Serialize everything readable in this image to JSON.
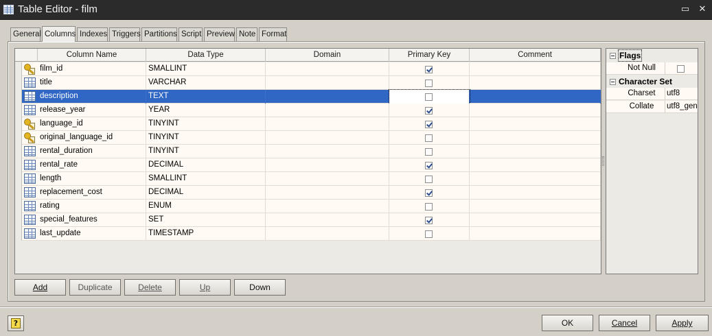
{
  "window": {
    "title": "Table Editor - film",
    "minimize_glyph": "▭",
    "close_glyph": "✕"
  },
  "tabs": [
    "General",
    "Columns",
    "Indexes",
    "Triggers",
    "Partitions",
    "Script",
    "Preview",
    "Note",
    "Format"
  ],
  "active_tab": "Columns",
  "grid": {
    "headers": [
      "Column Name",
      "Data Type",
      "Domain",
      "Primary Key",
      "Comment"
    ],
    "selected_row": 2,
    "rows": [
      {
        "name": "film_id",
        "type": "SMALLINT",
        "domain": "",
        "pk": true,
        "comment": "",
        "icon": "key-icon"
      },
      {
        "name": "title",
        "type": "VARCHAR",
        "domain": "",
        "pk": false,
        "comment": "",
        "icon": "table-column-icon"
      },
      {
        "name": "description",
        "type": "TEXT",
        "domain": "",
        "pk": false,
        "comment": "",
        "icon": "table-column-icon"
      },
      {
        "name": "release_year",
        "type": "YEAR",
        "domain": "",
        "pk": true,
        "comment": "",
        "icon": "table-column-icon"
      },
      {
        "name": "language_id",
        "type": "TINYINT",
        "domain": "",
        "pk": true,
        "comment": "",
        "icon": "key-icon"
      },
      {
        "name": "original_language_id",
        "type": "TINYINT",
        "domain": "",
        "pk": false,
        "comment": "",
        "icon": "key-icon"
      },
      {
        "name": "rental_duration",
        "type": "TINYINT",
        "domain": "",
        "pk": false,
        "comment": "",
        "icon": "table-column-icon"
      },
      {
        "name": "rental_rate",
        "type": "DECIMAL",
        "domain": "",
        "pk": true,
        "comment": "",
        "icon": "table-column-icon"
      },
      {
        "name": "length",
        "type": "SMALLINT",
        "domain": "",
        "pk": false,
        "comment": "",
        "icon": "table-column-icon"
      },
      {
        "name": "replacement_cost",
        "type": "DECIMAL",
        "domain": "",
        "pk": true,
        "comment": "",
        "icon": "table-column-icon"
      },
      {
        "name": "rating",
        "type": "ENUM",
        "domain": "",
        "pk": false,
        "comment": "",
        "icon": "table-column-icon"
      },
      {
        "name": "special_features",
        "type": "SET",
        "domain": "",
        "pk": true,
        "comment": "",
        "icon": "table-column-icon"
      },
      {
        "name": "last_update",
        "type": "TIMESTAMP",
        "domain": "",
        "pk": false,
        "comment": "",
        "icon": "table-column-icon"
      }
    ]
  },
  "properties": {
    "flags": {
      "title": "Flags",
      "not_null_label": "Not Null",
      "not_null": false
    },
    "charset_group": {
      "title": "Character Set",
      "charset_label": "Charset",
      "charset_value": "utf8",
      "collate_label": "Collate",
      "collate_value": "utf8_gen"
    }
  },
  "buttons": {
    "add": "Add",
    "duplicate": "Duplicate",
    "delete": "Delete",
    "up": "Up",
    "down": "Down",
    "ok": "OK",
    "cancel": "Cancel",
    "apply": "Apply",
    "help": "?"
  }
}
